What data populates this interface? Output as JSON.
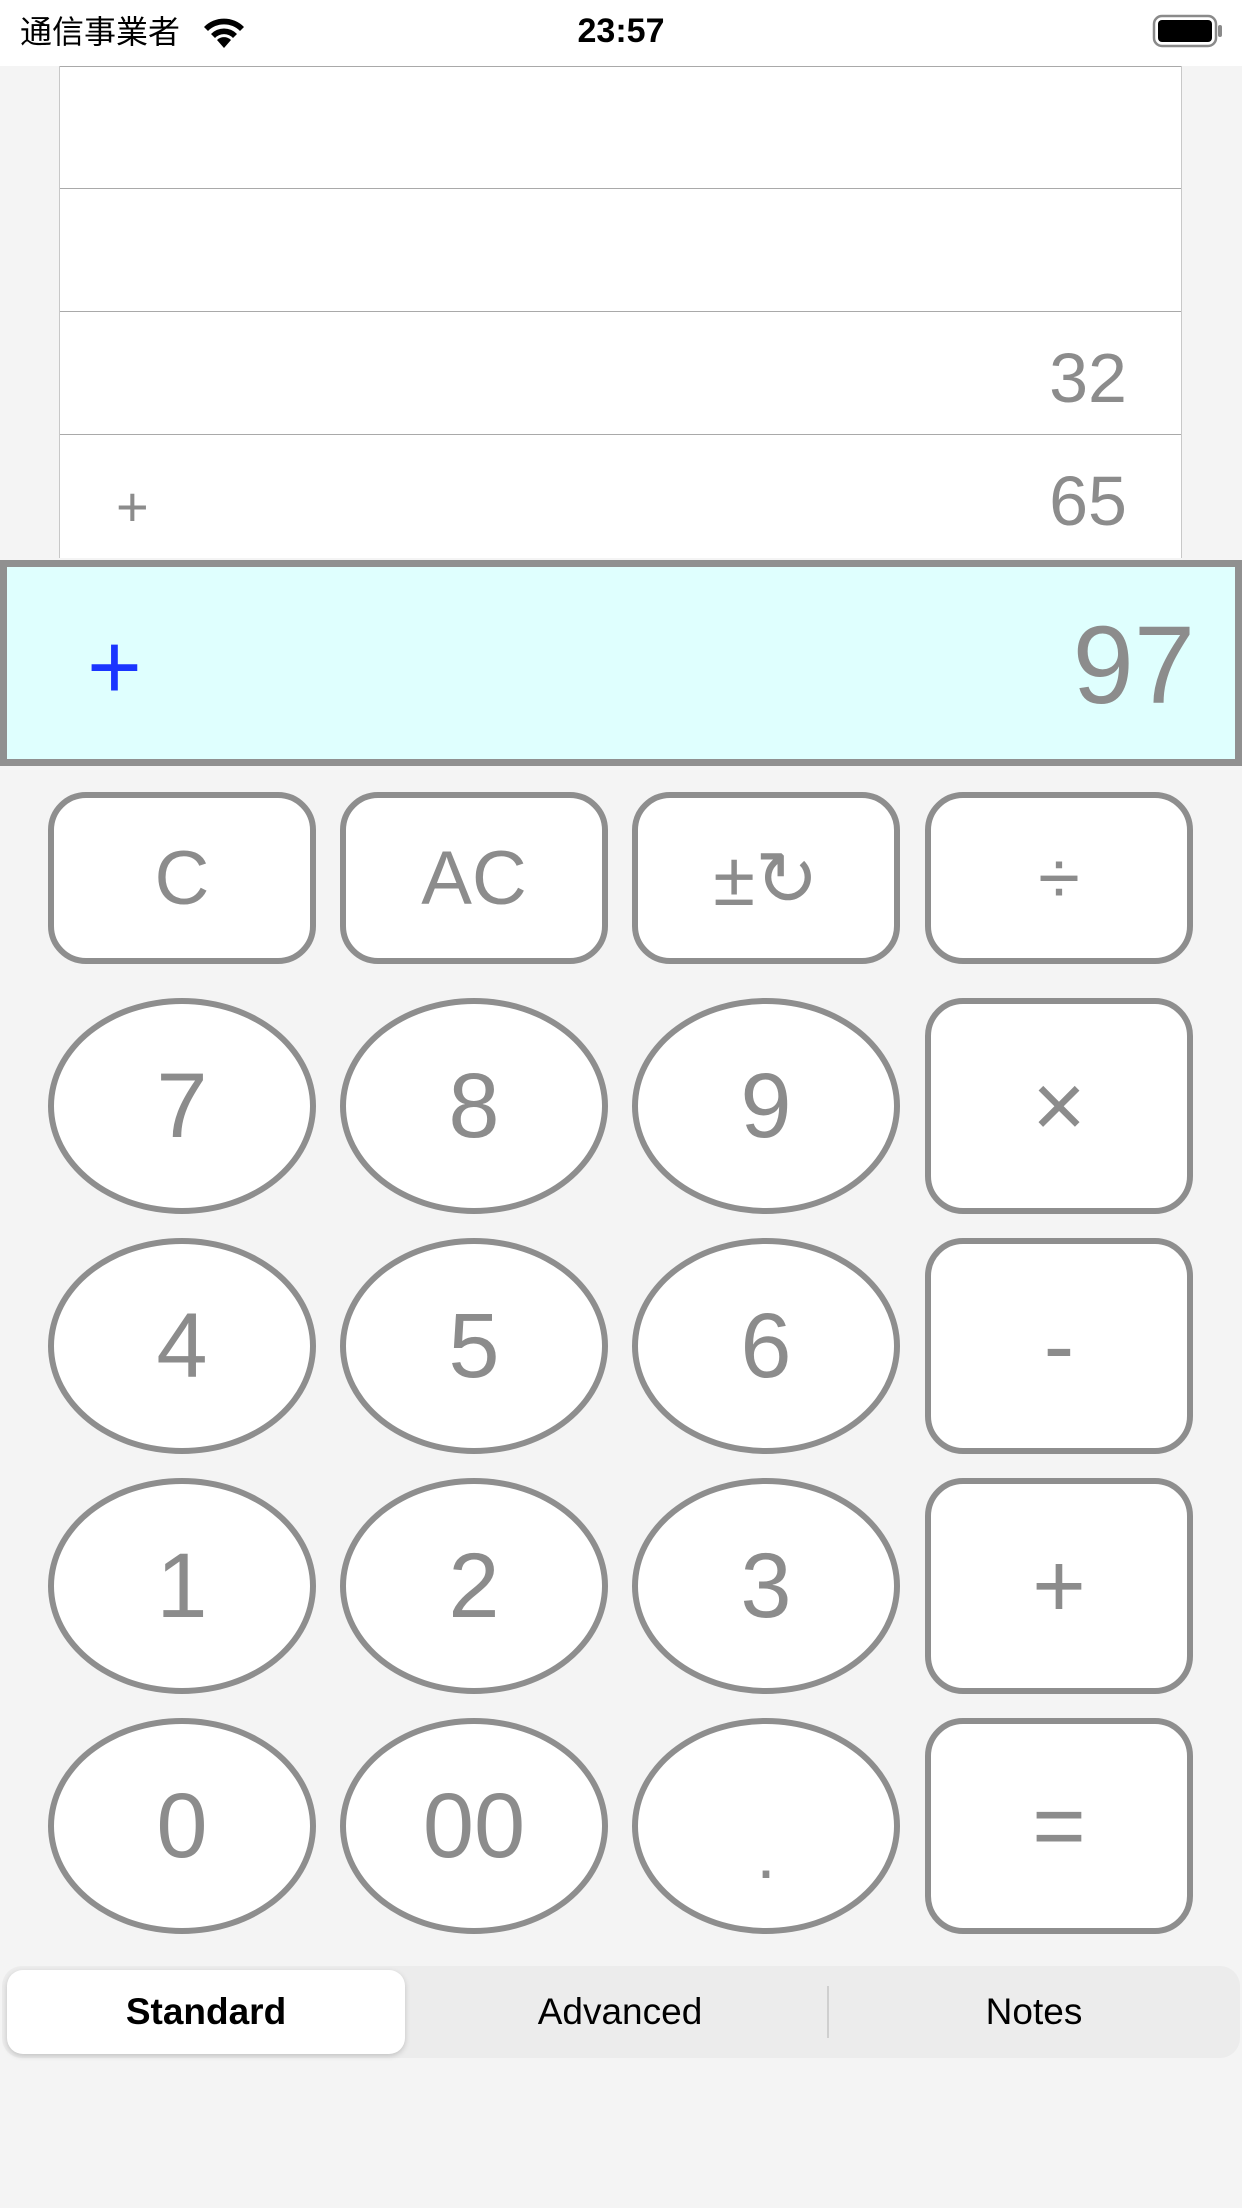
{
  "status_bar": {
    "carrier": "通信事業者",
    "time": "23:57"
  },
  "tape": {
    "rows": [
      {
        "op": "",
        "value": ""
      },
      {
        "op": "",
        "value": ""
      },
      {
        "op": "",
        "value": "32"
      },
      {
        "op": "+",
        "value": "65"
      }
    ]
  },
  "display": {
    "operator": "+",
    "value": "97"
  },
  "keys": {
    "clear": "C",
    "all_clear": "AC",
    "sign_toggle": "±↻",
    "divide": "÷",
    "seven": "7",
    "eight": "8",
    "nine": "9",
    "multiply": "×",
    "four": "4",
    "five": "5",
    "six": "6",
    "subtract": "-",
    "one": "1",
    "two": "2",
    "three": "3",
    "add": "+",
    "zero": "0",
    "double_zero": "00",
    "decimal": ".",
    "equals": "="
  },
  "tabs": {
    "standard": "Standard",
    "advanced": "Advanced",
    "notes": "Notes",
    "selected": "Standard"
  },
  "colors": {
    "display_background": "#dffffe",
    "operator_accent": "#1a35ff",
    "key_border": "#8e8e8e",
    "key_text": "#8c8c8c"
  }
}
